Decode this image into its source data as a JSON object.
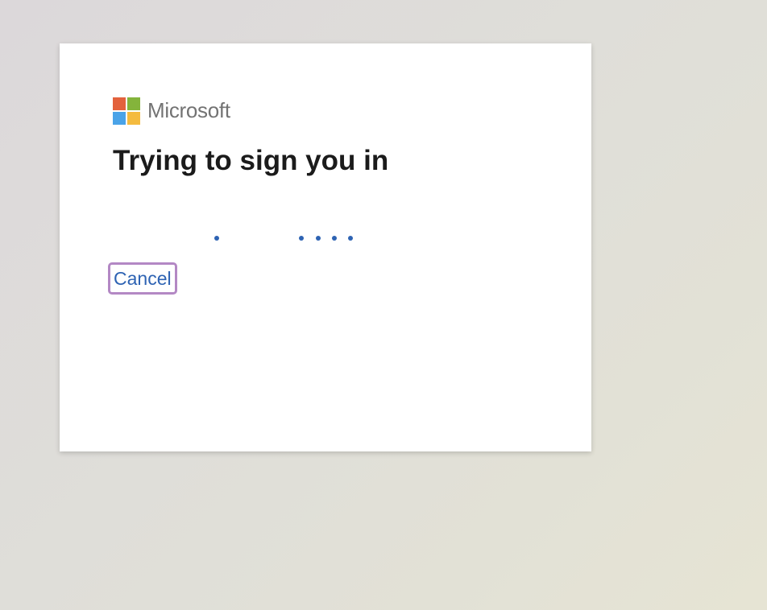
{
  "brand": {
    "name": "Microsoft",
    "logo_colors": [
      "#f25022",
      "#7fba00",
      "#00a4ef",
      "#ffb900"
    ],
    "logo_colors_rendered": [
      "#e3623d",
      "#84b43b",
      "#4aa3e8",
      "#f4bb3f"
    ]
  },
  "dialog": {
    "title": "Trying to sign you in",
    "cancel_label": "Cancel"
  },
  "progress": {
    "dot_count": 5,
    "dot_color": "#2e63b3"
  },
  "colors": {
    "link": "#2e63b3",
    "focus_ring": "#b388c4",
    "title": "#1b1b1b",
    "brand_text": "#737373"
  }
}
